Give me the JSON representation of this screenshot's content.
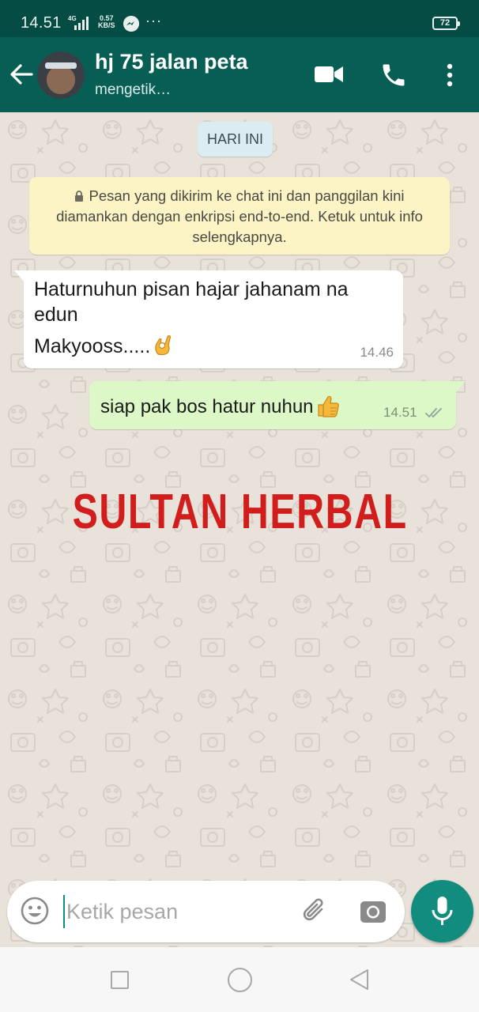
{
  "status_bar": {
    "time": "14.51",
    "network": "4G",
    "speed_value": "0.57",
    "speed_unit": "KB/S",
    "more_indicator": "···",
    "battery": "72"
  },
  "header": {
    "contact_name": "hj 75 jalan peta",
    "contact_status": "mengetik…",
    "icons": {
      "back": "arrow-left-icon",
      "video": "video-call-icon",
      "call": "phone-icon",
      "menu": "more-vertical-icon"
    }
  },
  "chat": {
    "date_label": "HARI INI",
    "encryption_notice": "Pesan yang dikirim ke chat ini dan panggilan kini diamankan dengan enkripsi end-to-end. Ketuk untuk info selengkapnya.",
    "messages": [
      {
        "direction": "incoming",
        "line1": "Haturnuhun pisan hajar jahanam na",
        "line2": "edun",
        "line3": "Makyooss.....",
        "emoji": "ok-hand-emoji",
        "time": "14.46"
      },
      {
        "direction": "outgoing",
        "text": "siap pak bos hatur nuhun",
        "emoji": "thumbs-up-emoji",
        "time": "14.51",
        "status": "read"
      }
    ],
    "overlay_text": "SULTAN HERBAL"
  },
  "composer": {
    "placeholder": "Ketik pesan",
    "value": "",
    "icons": {
      "emoji": "smiley-icon",
      "attach": "paperclip-icon",
      "camera": "camera-icon",
      "mic": "microphone-icon"
    }
  },
  "colors": {
    "header": "#075e54",
    "status_bar": "#054d44",
    "outgoing_bubble": "#dcf8c6",
    "incoming_bubble": "#ffffff",
    "notice": "#fdf4c5",
    "accent": "#128c7e",
    "overlay_text": "#d21d1d"
  }
}
